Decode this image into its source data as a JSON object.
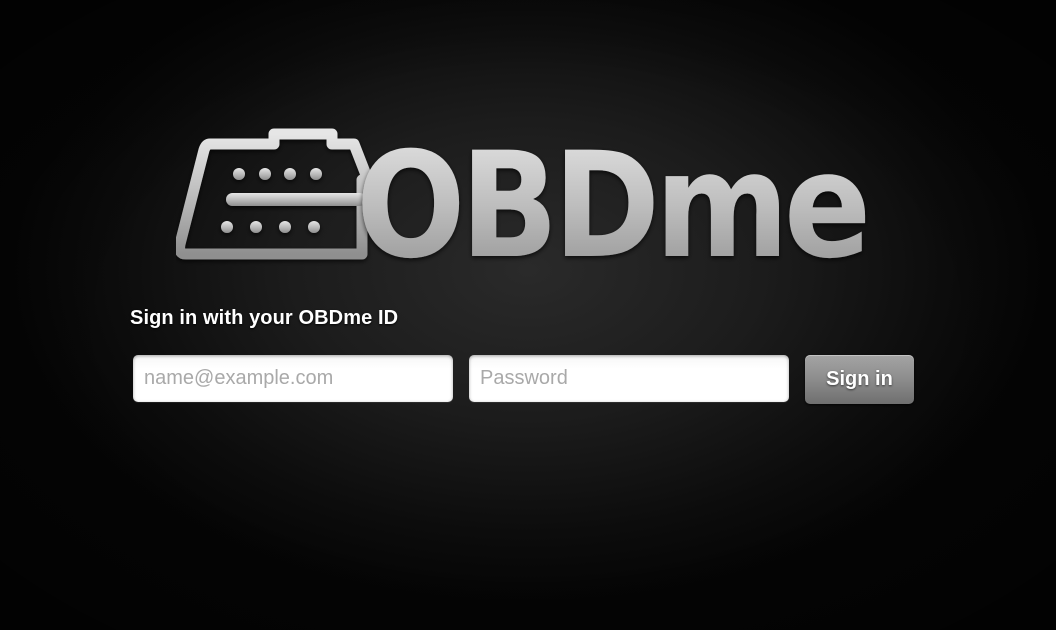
{
  "logo": {
    "text": "OBDme",
    "icon": "obd-connector-icon"
  },
  "signin_form": {
    "heading": "Sign in with your OBDme ID",
    "email_placeholder": "name@example.com",
    "email_value": "",
    "password_placeholder": "Password",
    "password_value": "",
    "submit_label": "Sign in"
  },
  "colors": {
    "background": "#1c1c1c",
    "logo_silver": "#b8b8b8",
    "button": "#8c8c8c",
    "heading_text": "#ffffff"
  }
}
